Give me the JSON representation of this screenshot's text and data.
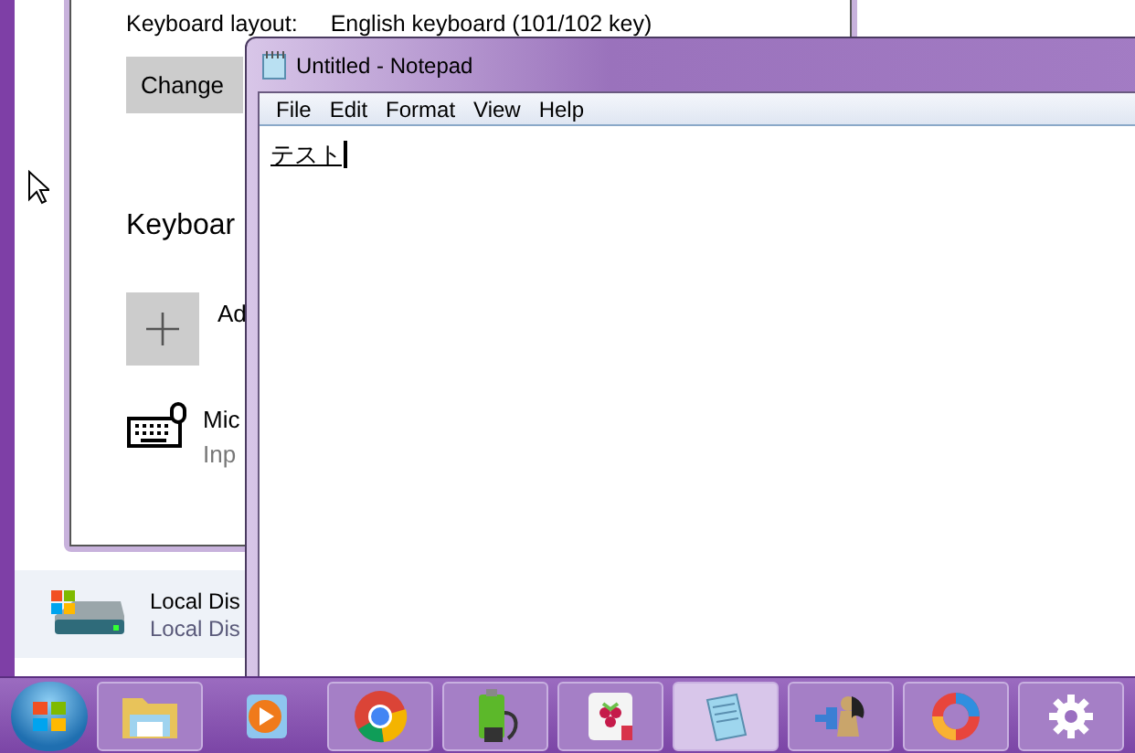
{
  "settings_window": {
    "layout_label": "Keyboard layout:",
    "layout_value": "English keyboard (101/102 key)",
    "change_button": "Change",
    "heading": "Keyboar",
    "add_item": {
      "label": "Ad"
    },
    "keyboard_item": {
      "title": "Mic",
      "subtitle": "Inp"
    }
  },
  "explorer": {
    "drive": {
      "name": "Local Dis",
      "type": "Local Dis"
    }
  },
  "notepad": {
    "title": "Untitled - Notepad",
    "menu": [
      "File",
      "Edit",
      "Format",
      "View",
      "Help"
    ],
    "text": "テスト",
    "composing": true
  },
  "taskbar": {
    "items": [
      {
        "kind": "folder",
        "running": true,
        "selected": false
      },
      {
        "kind": "media",
        "running": false,
        "selected": false
      },
      {
        "kind": "chrome",
        "running": true,
        "selected": false
      },
      {
        "kind": "battery",
        "running": true,
        "selected": false
      },
      {
        "kind": "raspberry",
        "running": true,
        "selected": false
      },
      {
        "kind": "notepad",
        "running": true,
        "selected": true
      },
      {
        "kind": "chess",
        "running": true,
        "selected": false
      },
      {
        "kind": "ring",
        "running": true,
        "selected": false
      },
      {
        "kind": "gear",
        "running": true,
        "selected": false
      }
    ]
  }
}
